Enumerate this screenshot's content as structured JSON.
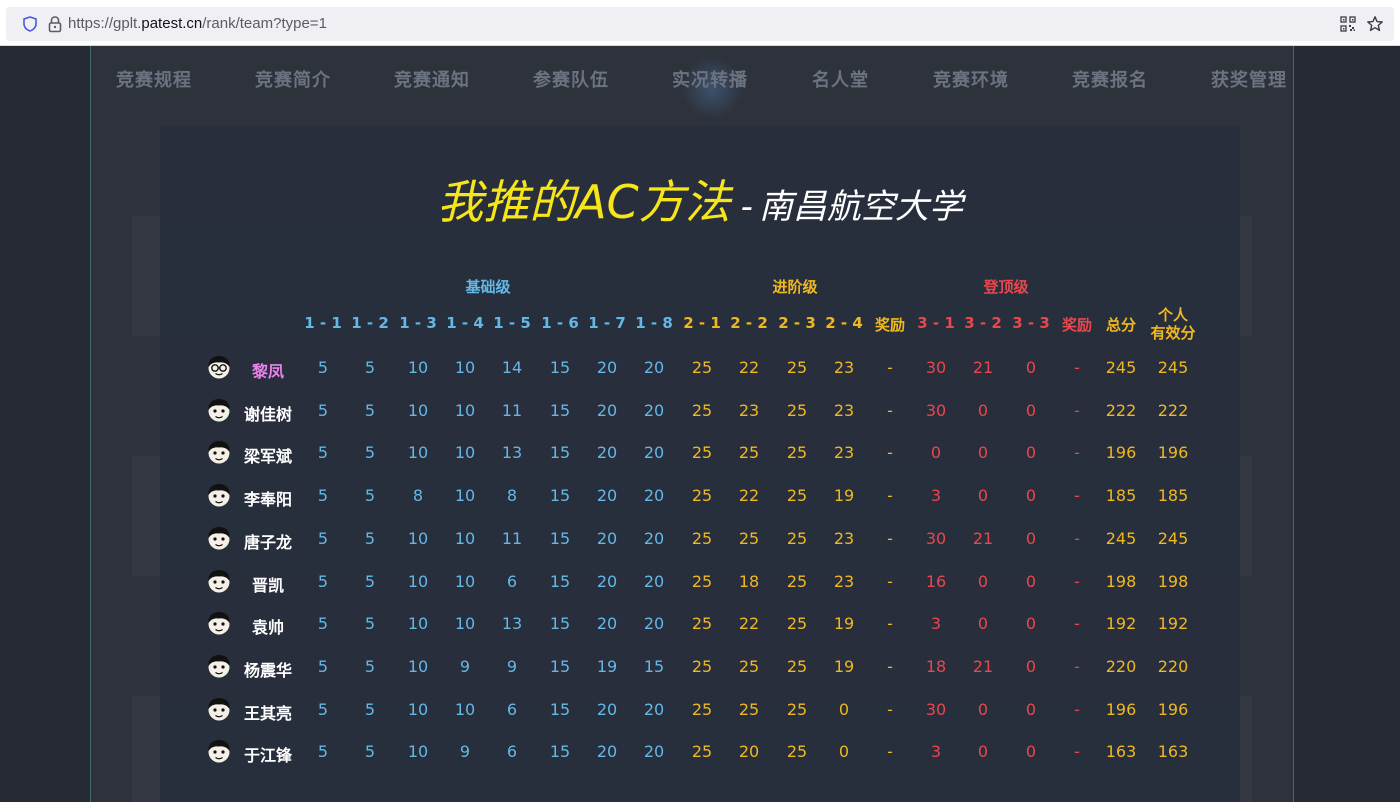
{
  "browser": {
    "url_prefix": "https://gplt.",
    "url_host": "patest.cn",
    "url_path": "/rank/team?type=1"
  },
  "nav": {
    "items": [
      "竞赛规程",
      "竞赛简介",
      "竞赛通知",
      "参赛队伍",
      "实况转播",
      "名人堂",
      "竞赛环境",
      "竞赛报名",
      "获奖管理"
    ]
  },
  "overlay": {
    "title": "我推的AC方法",
    "separator": "-",
    "school": "南昌航空大学",
    "groups": {
      "basic": "基础级",
      "advanced": "进阶级",
      "top": "登顶级"
    },
    "headers": [
      "1 - 1",
      "1 - 2",
      "1 - 3",
      "1 - 4",
      "1 - 5",
      "1 - 6",
      "1 - 7",
      "1 - 8",
      "2 - 1",
      "2 - 2",
      "2 - 3",
      "2 - 4",
      "奖励",
      "3 - 1",
      "3 - 2",
      "3 - 3",
      "奖励",
      "总分"
    ],
    "personal_header_line1": "个人",
    "personal_header_line2": "有效分",
    "members": [
      {
        "name": "黎凤",
        "highlight": true,
        "scores": [
          "5",
          "5",
          "10",
          "10",
          "14",
          "15",
          "20",
          "20",
          "25",
          "22",
          "25",
          "23",
          "-",
          "30",
          "21",
          "0",
          "-",
          "245",
          "245"
        ]
      },
      {
        "name": "谢佳树",
        "highlight": false,
        "scores": [
          "5",
          "5",
          "10",
          "10",
          "11",
          "15",
          "20",
          "20",
          "25",
          "23",
          "25",
          "23",
          "-",
          "30",
          "0",
          "0",
          "-",
          "222",
          "222"
        ]
      },
      {
        "name": "梁军斌",
        "highlight": false,
        "scores": [
          "5",
          "5",
          "10",
          "10",
          "13",
          "15",
          "20",
          "20",
          "25",
          "25",
          "25",
          "23",
          "-",
          "0",
          "0",
          "0",
          "-",
          "196",
          "196"
        ]
      },
      {
        "name": "李奉阳",
        "highlight": false,
        "scores": [
          "5",
          "5",
          "8",
          "10",
          "8",
          "15",
          "20",
          "20",
          "25",
          "22",
          "25",
          "19",
          "-",
          "3",
          "0",
          "0",
          "-",
          "185",
          "185"
        ]
      },
      {
        "name": "唐子龙",
        "highlight": false,
        "scores": [
          "5",
          "5",
          "10",
          "10",
          "11",
          "15",
          "20",
          "20",
          "25",
          "25",
          "25",
          "23",
          "-",
          "30",
          "21",
          "0",
          "-",
          "245",
          "245"
        ]
      },
      {
        "name": "晋凯",
        "highlight": false,
        "scores": [
          "5",
          "5",
          "10",
          "10",
          "6",
          "15",
          "20",
          "20",
          "25",
          "18",
          "25",
          "23",
          "-",
          "16",
          "0",
          "0",
          "-",
          "198",
          "198"
        ]
      },
      {
        "name": "袁帅",
        "highlight": false,
        "scores": [
          "5",
          "5",
          "10",
          "10",
          "13",
          "15",
          "20",
          "20",
          "25",
          "22",
          "25",
          "19",
          "-",
          "3",
          "0",
          "0",
          "-",
          "192",
          "192"
        ]
      },
      {
        "name": "杨震华",
        "highlight": false,
        "scores": [
          "5",
          "5",
          "10",
          "9",
          "9",
          "15",
          "19",
          "15",
          "25",
          "25",
          "25",
          "19",
          "-",
          "18",
          "21",
          "0",
          "-",
          "220",
          "220"
        ]
      },
      {
        "name": "王其亮",
        "highlight": false,
        "scores": [
          "5",
          "5",
          "10",
          "10",
          "6",
          "15",
          "20",
          "20",
          "25",
          "25",
          "25",
          "0",
          "-",
          "30",
          "0",
          "0",
          "-",
          "196",
          "196"
        ]
      },
      {
        "name": "于江锋",
        "highlight": false,
        "scores": [
          "5",
          "5",
          "10",
          "9",
          "6",
          "15",
          "20",
          "20",
          "25",
          "20",
          "25",
          "0",
          "-",
          "3",
          "0",
          "0",
          "-",
          "163",
          "163"
        ]
      }
    ]
  },
  "colors": {
    "basic": "#63b8e8",
    "advanced": "#f0b820",
    "top": "#e8474d",
    "title": "#f5e51a",
    "highlight_name": "#e883e8"
  }
}
